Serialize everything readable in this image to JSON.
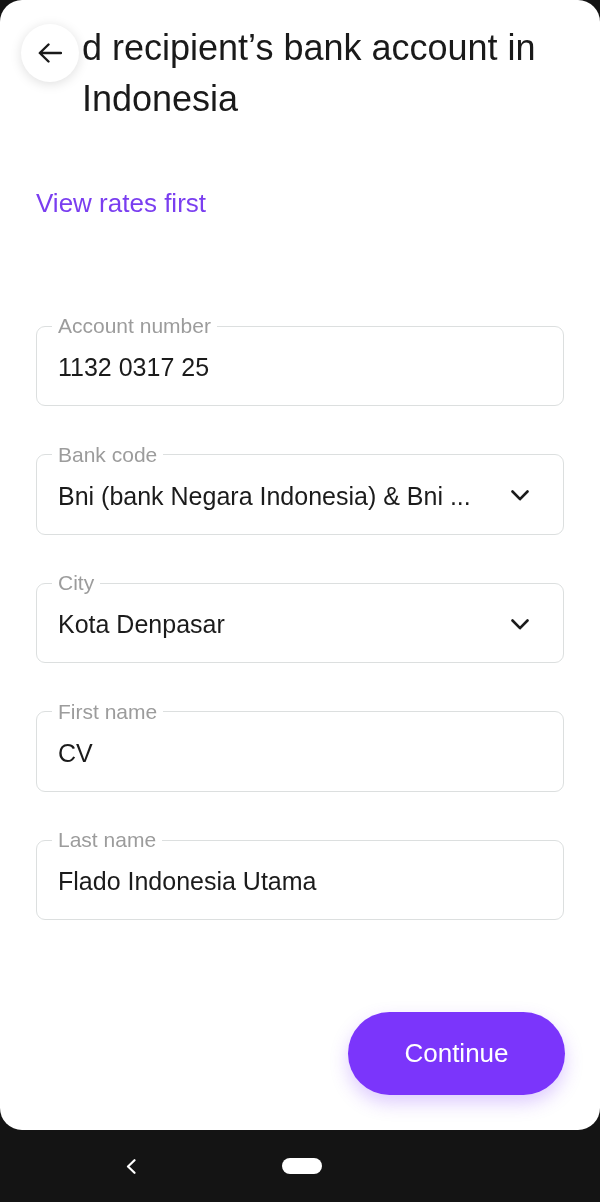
{
  "header": {
    "title": "d recipient’s bank account in Indonesia",
    "link": "View rates first"
  },
  "fields": [
    {
      "kind": "text",
      "label": "Account number",
      "value": "1132 0317 25"
    },
    {
      "kind": "dropdown",
      "label": "Bank code",
      "value": "Bni (bank Negara Indonesia) & Bni ..."
    },
    {
      "kind": "dropdown",
      "label": "City",
      "value": "Kota Denpasar"
    },
    {
      "kind": "text",
      "label": "First name",
      "value": "CV"
    },
    {
      "kind": "text",
      "label": "Last name",
      "value": "Flado Indonesia Utama"
    }
  ],
  "primary_button": {
    "label": "Continue"
  }
}
